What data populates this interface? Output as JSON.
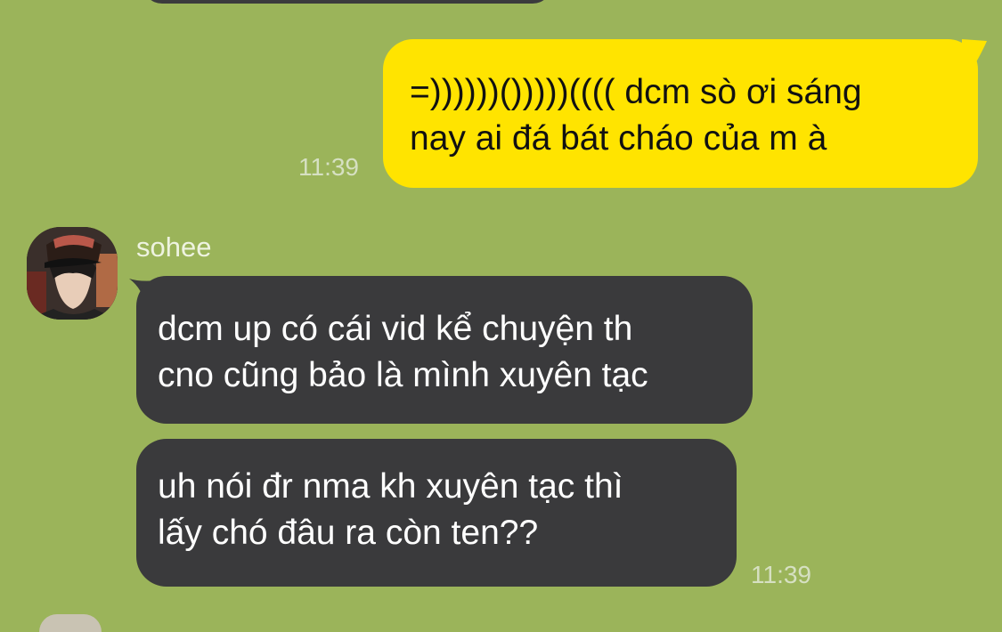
{
  "messages": [
    {
      "direction": "outgoing",
      "lines": [
        "=))))))()))))(((( dcm sò ơi sáng",
        "nay ai đá bát cháo của m à"
      ],
      "time": "11:39"
    },
    {
      "direction": "incoming",
      "sender": "sohee",
      "lines": [
        "dcm up có cái vid kể chuyện th",
        "cno cũng bảo là mình xuyên tạc"
      ]
    },
    {
      "direction": "incoming",
      "sender": "sohee",
      "lines": [
        "uh nói đr nma kh xuyên tạc thì",
        "lấy chó đâu ra còn ten??"
      ],
      "time": "11:39"
    }
  ],
  "contact": {
    "name": "sohee",
    "avatar_icon": "profile-photo"
  },
  "colors": {
    "background": "#9bb45a",
    "outgoing_bubble": "#ffe400",
    "incoming_bubble": "#3a3a3c",
    "timestamp": "#d6e0c2"
  }
}
